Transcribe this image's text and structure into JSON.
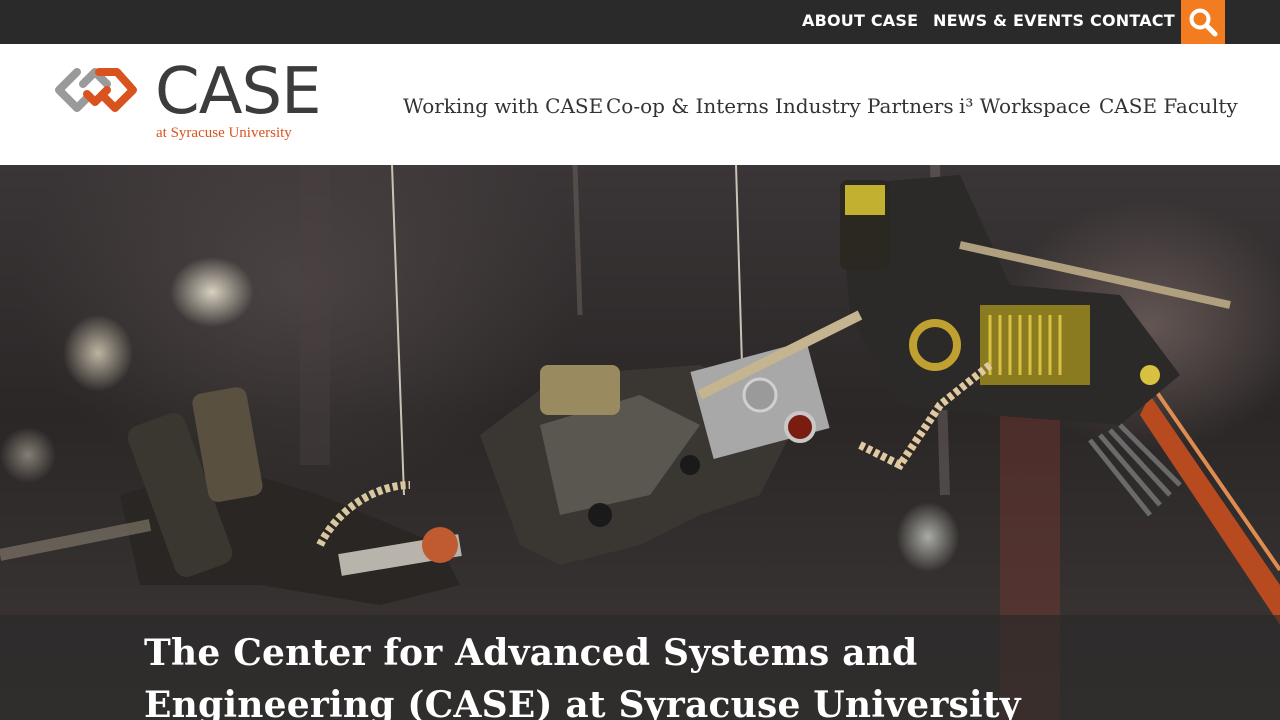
{
  "utility_nav": {
    "items": [
      "ABOUT CASE",
      "NEWS & EVENTS",
      "CONTACT"
    ],
    "search_icon": "search-icon"
  },
  "logo": {
    "wordmark": "CASE",
    "subtitle": "at Syracuse University",
    "icon": "interlocking-chain-icon"
  },
  "main_nav": {
    "items": [
      "Working with CASE",
      "Co-op & Interns",
      "Industry Partners",
      "i³ Workspace",
      "CASE Faculty"
    ]
  },
  "hero": {
    "image": "robotic-insect-photo",
    "title": "The Center for Advanced Systems and Engineering (CASE) at Syracuse University"
  },
  "colors": {
    "topbar_bg": "#2a2a2a",
    "accent_orange": "#f47c20",
    "logo_orange": "#d9531e",
    "logo_gray": "#3c3c3c"
  }
}
